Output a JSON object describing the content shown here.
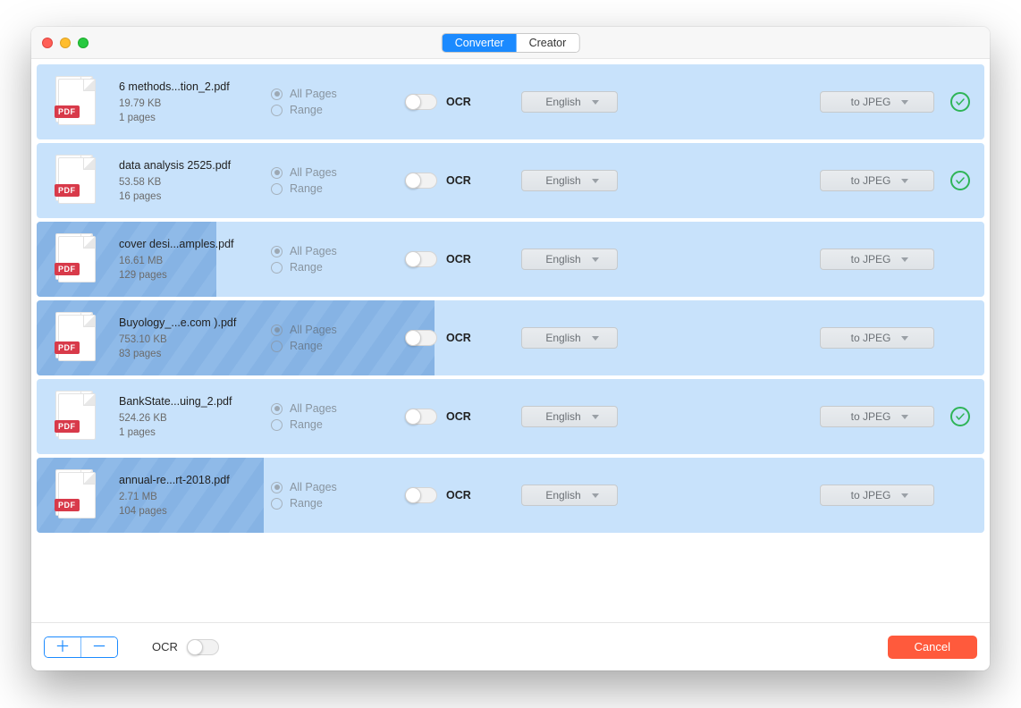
{
  "header": {
    "tabs": [
      {
        "label": "Converter",
        "active": true
      },
      {
        "label": "Creator",
        "active": false
      }
    ]
  },
  "labels": {
    "pdf_badge": "PDF",
    "all_pages": "All Pages",
    "range": "Range",
    "ocr": "OCR"
  },
  "files": [
    {
      "name": "6 methods...tion_2.pdf",
      "size": "19.79 KB",
      "pages": "1 pages",
      "language": "English",
      "format": "to JPEG",
      "progress": 100,
      "done": true
    },
    {
      "name": "data analysis 2525.pdf",
      "size": "53.58 KB",
      "pages": "16 pages",
      "language": "English",
      "format": "to JPEG",
      "progress": 100,
      "done": true
    },
    {
      "name": "cover desi...amples.pdf",
      "size": "16.61 MB",
      "pages": "129 pages",
      "language": "English",
      "format": "to JPEG",
      "progress": 19,
      "done": false
    },
    {
      "name": "Buyology_...e.com ).pdf",
      "size": "753.10 KB",
      "pages": "83 pages",
      "language": "English",
      "format": "to JPEG",
      "progress": 42,
      "done": false
    },
    {
      "name": "BankState...uing_2.pdf",
      "size": "524.26 KB",
      "pages": "1 pages",
      "language": "English",
      "format": "to JPEG",
      "progress": 100,
      "done": true
    },
    {
      "name": "annual-re...rt-2018.pdf",
      "size": "2.71 MB",
      "pages": "104 pages",
      "language": "English",
      "format": "to JPEG",
      "progress": 24,
      "done": false
    }
  ],
  "footer": {
    "ocr_label": "OCR",
    "cancel": "Cancel"
  }
}
